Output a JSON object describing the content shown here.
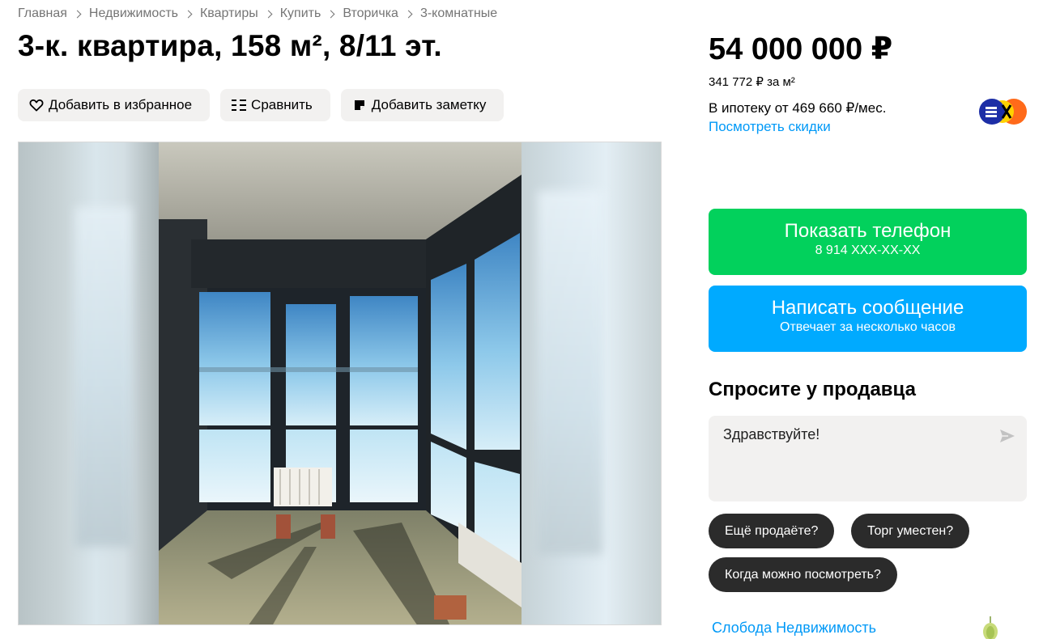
{
  "breadcrumb": [
    "Главная",
    "Недвижимость",
    "Квартиры",
    "Купить",
    "Вторичка",
    "3-комнатные"
  ],
  "title": "3-к. квартира, 158 м², 8/11 эт.",
  "actions": {
    "favorite": "Добавить в избранное",
    "compare": "Сравнить",
    "note": "Добавить заметку"
  },
  "price": {
    "total": "54 000 000 ₽",
    "per_m2": "341 772 ₽ за м²",
    "mortgage": "В ипотеку от 469 660 ₽/мес.",
    "discount_link": "Посмотреть скидки"
  },
  "contact": {
    "phone_label": "Показать телефон",
    "phone_value": "8 914 XXX-XX-XX",
    "message_label": "Написать сообщение",
    "message_sub": "Отвечает за несколько часов"
  },
  "ask": {
    "title": "Спросите у продавца",
    "message": "Здравствуйте!",
    "chips": [
      "Ещё продаёте?",
      "Торг уместен?",
      "Когда можно посмотреть?"
    ]
  },
  "seller": {
    "name": "Слобода Недвижимость"
  },
  "colors": {
    "green": "#02d15c",
    "blue": "#00aaff",
    "link": "#0099f7",
    "chip": "#2b2b2b",
    "button_bg": "#f2f1f0"
  },
  "icons": {
    "favorite": "heart-icon",
    "compare": "compare-icon",
    "note": "note-icon",
    "send": "send-icon",
    "bank": "bank-logo"
  }
}
